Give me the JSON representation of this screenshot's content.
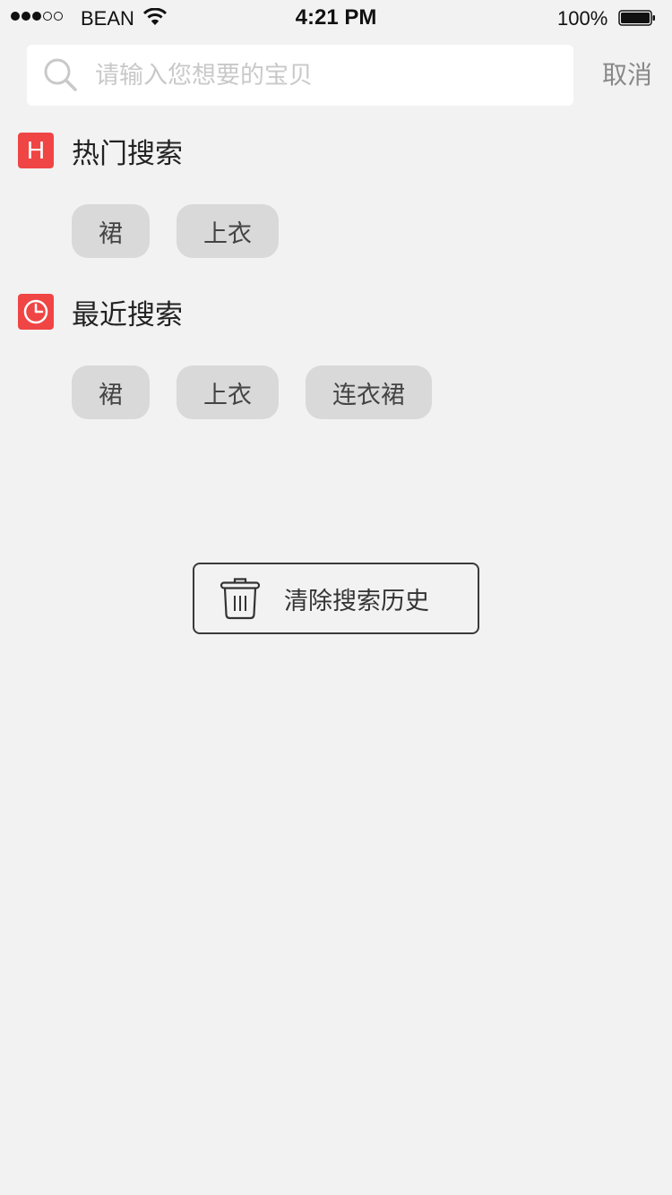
{
  "status_bar": {
    "carrier": "BEAN",
    "time": "4:21 PM",
    "battery": "100%",
    "signal_bars_filled": 3,
    "signal_bars_total": 5
  },
  "search": {
    "placeholder": "请输入您想要的宝贝",
    "value": "",
    "cancel_label": "取消"
  },
  "hot_search": {
    "badge": "H",
    "title": "热门搜索",
    "icon": "hot-h-icon",
    "tags": [
      "裙",
      "上衣"
    ]
  },
  "recent_search": {
    "title": "最近搜索",
    "icon": "clock-icon",
    "tags": [
      "裙",
      "上衣",
      "连衣裙"
    ]
  },
  "clear_history": {
    "label": "清除搜索历史",
    "icon": "trash-icon"
  },
  "colors": {
    "accent": "#f04545",
    "background": "#f2f2f2",
    "tag_background": "#d9d9d9"
  }
}
